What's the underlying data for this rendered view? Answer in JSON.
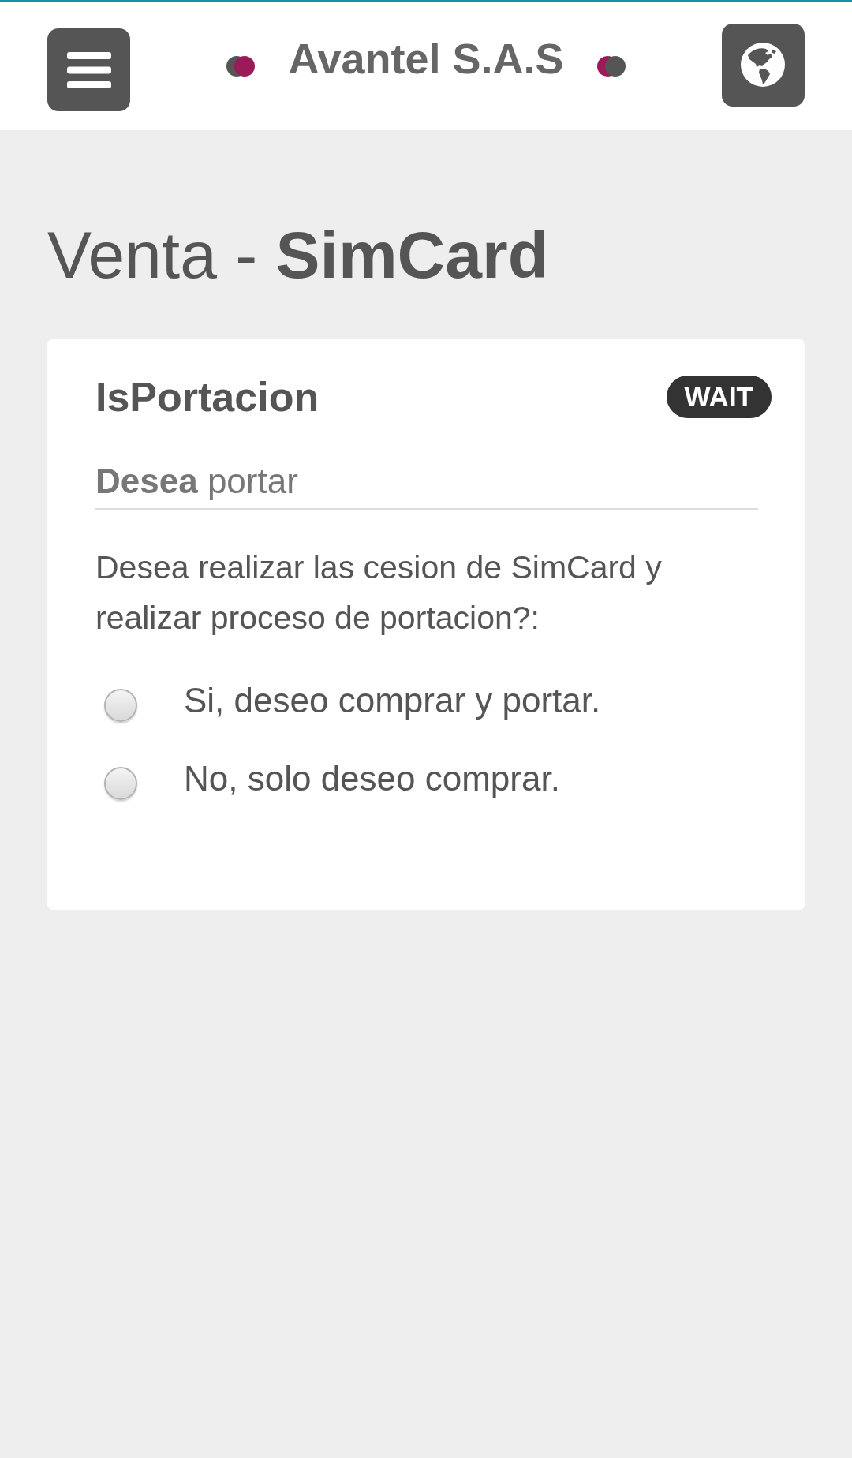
{
  "header": {
    "title": "Avantel S.A.S"
  },
  "page_title": "Venta - **SimCard**",
  "card": {
    "title": "IsPortacion",
    "badge": "WAIT",
    "legend": "**Desea** portar",
    "question": "Desea realizar las cesion de SimCard y realizar proceso de portacion?:",
    "options": [
      {
        "label": "Si, deseo comprar y portar.",
        "selected": false
      },
      {
        "label": "No, solo deseo comprar.",
        "selected": false
      }
    ]
  }
}
